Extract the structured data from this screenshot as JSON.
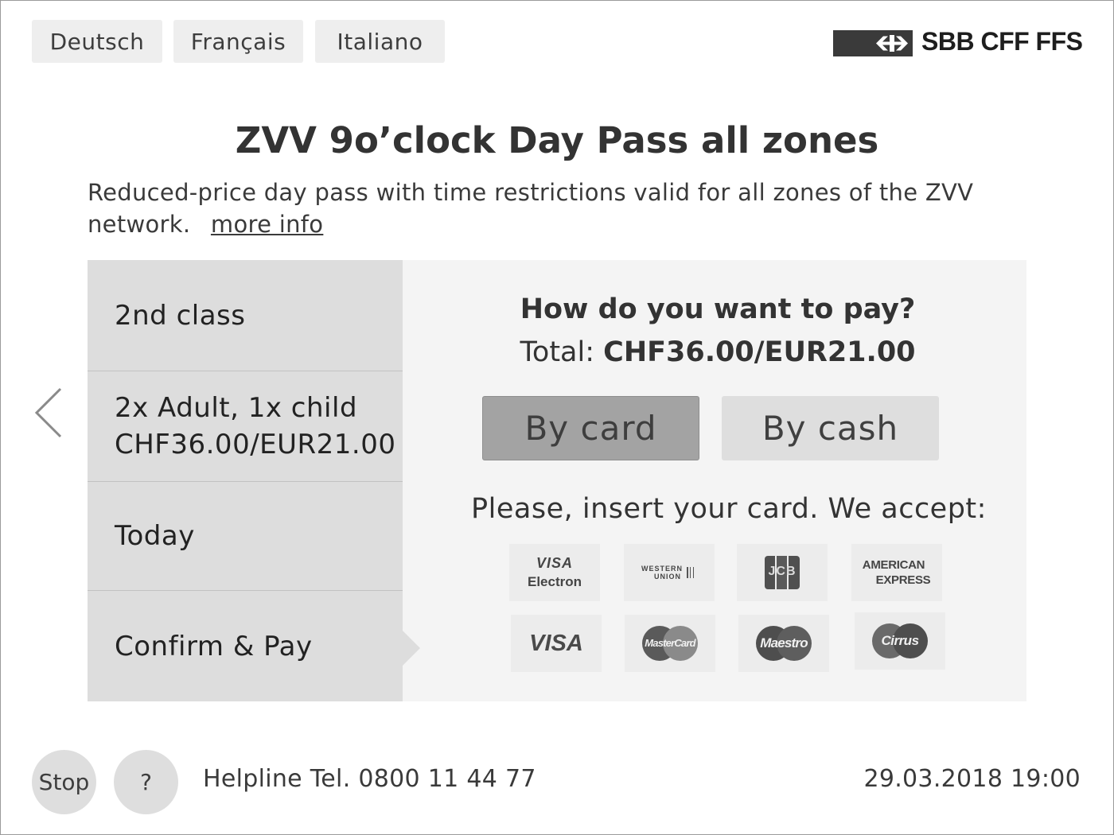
{
  "languages": [
    "Deutsch",
    "Français",
    "Italiano"
  ],
  "logo": {
    "text": "SBB CFF FFS"
  },
  "ticket": {
    "title": "ZVV 9o’clock Day Pass all zones",
    "description": "Reduced-price day pass with time restrictions valid for all zones of the ZVV network.",
    "more_info": "more info"
  },
  "steps": {
    "class": "2nd class",
    "passengers": "2x Adult, 1x child",
    "price": "CHF36.00/EUR21.00",
    "date": "Today",
    "confirm": "Confirm & Pay"
  },
  "payment": {
    "question": "How do you want to pay?",
    "total_label": "Total:",
    "total_value": "CHF36.00/EUR21.00",
    "by_card": "By card",
    "by_cash": "By cash",
    "insert_text": "Please, insert your card. We accept:",
    "cards": {
      "visa_electron_1": "VISA",
      "visa_electron_2": "Electron",
      "western_union_1": "WESTERN",
      "western_union_2": "UNION",
      "jcb": "JCB",
      "amex_1": "AMERICAN",
      "amex_2": "EXPRESS",
      "visa": "VISA",
      "mastercard": "MasterCard",
      "maestro": "Maestro",
      "cirrus": "Cirrus"
    }
  },
  "footer": {
    "stop": "Stop",
    "help": "?",
    "helpline": "Helpline Tel. 0800 11 44 77",
    "datetime": "29.03.2018 19:00"
  },
  "colors": {
    "selected_button": "#a3a3a3",
    "button": "#dedede",
    "panel": "#f4f4f4",
    "steps": "#dddddd"
  }
}
